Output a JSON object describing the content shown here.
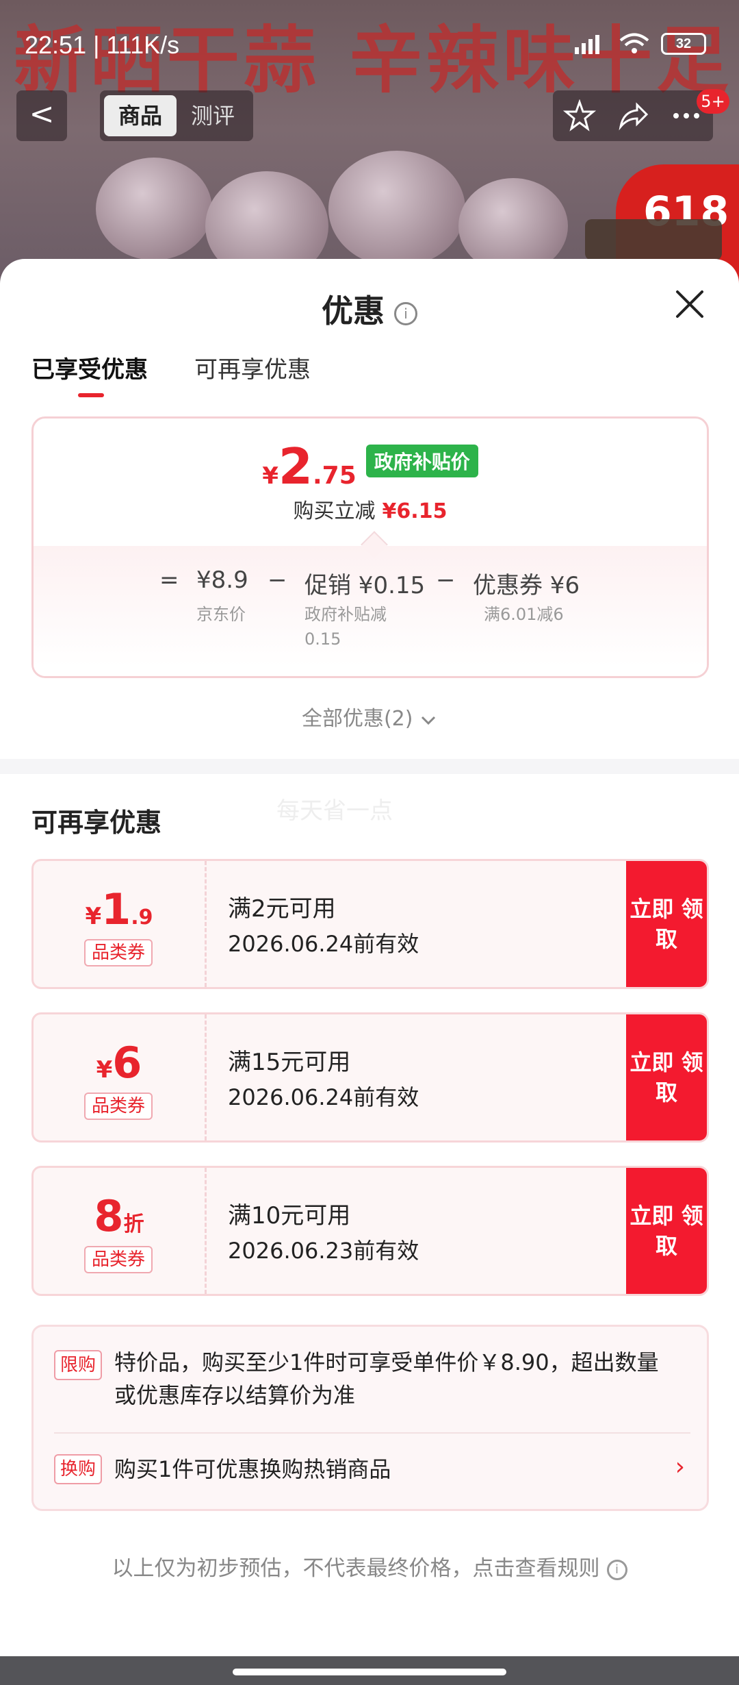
{
  "status_bar": {
    "time": "22:51 | 111K/s",
    "battery": "32"
  },
  "background": {
    "banner_text": "新晒干蒜 辛辣味十足",
    "badge": "618"
  },
  "top_nav": {
    "back": "<",
    "tabs": [
      "商品",
      "测评"
    ],
    "notification_count": "5+"
  },
  "sheet": {
    "title": "优惠",
    "tabs": [
      "已享受优惠",
      "可再享优惠"
    ],
    "price": {
      "currency": "¥",
      "integer": "2",
      "decimal": ".75",
      "tag": "政府补贴价"
    },
    "instant_reduce": {
      "label": "购买立减",
      "value": "¥6.15"
    },
    "calc": {
      "equals": "=",
      "minus": "−",
      "items": [
        {
          "main": "¥8.9",
          "sub": "京东价"
        },
        {
          "main": "促销 ¥0.15",
          "sub": "政府补贴减 0.15"
        },
        {
          "main": "优惠券 ¥6",
          "sub": "满6.01减6"
        }
      ]
    },
    "all_promos": "全部优惠(2)",
    "more_section": {
      "title": "可再享优惠",
      "watermark": "每天省一点"
    },
    "coupons": [
      {
        "sym": "¥",
        "big": "1",
        "small": ".9",
        "type": "品类券",
        "condition": "满2元可用",
        "valid": "2026.06.24前有效",
        "button": "立即 领取"
      },
      {
        "sym": "¥",
        "big": "6",
        "small": "",
        "type": "品类券",
        "condition": "满15元可用",
        "valid": "2026.06.24前有效",
        "button": "立即 领取"
      },
      {
        "sym": "",
        "big": "8",
        "small": "折",
        "type": "品类券",
        "condition": "满10元可用",
        "valid": "2026.06.23前有效",
        "button": "立即 领取"
      }
    ],
    "notices": [
      {
        "tag": "限购",
        "text": "特价品，购买至少1件时可享受单件价￥8.90，超出数量或优惠库存以结算价为准"
      },
      {
        "tag": "换购",
        "text": "购买1件可优惠换购热销商品"
      }
    ],
    "footer": "以上仅为初步预估，不代表最终价格，点击查看规则",
    "colors": {
      "accent": "#e8242d",
      "green_tag": "#2db34a",
      "button": "#f31a2f"
    }
  }
}
